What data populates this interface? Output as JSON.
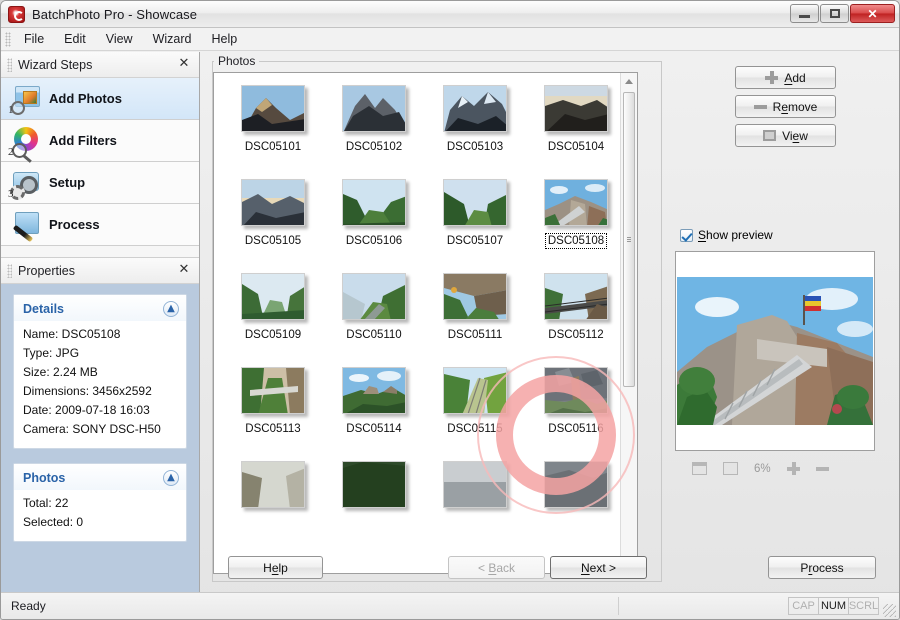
{
  "window": {
    "title": "BatchPhoto Pro - Showcase",
    "app_icon": "batchphoto-logo-icon",
    "minimize": "minimize-icon",
    "maximize": "maximize-icon",
    "close": "close-icon"
  },
  "menubar": {
    "items": [
      "File",
      "Edit",
      "View",
      "Wizard",
      "Help"
    ]
  },
  "sidebar": {
    "wizard": {
      "title": "Wizard Steps",
      "close": "✕",
      "steps": [
        {
          "num": "1",
          "label": "Add Photos",
          "icon": "add-photos-icon",
          "active": true
        },
        {
          "num": "2",
          "label": "Add Filters",
          "icon": "add-filters-icon",
          "active": false
        },
        {
          "num": "3",
          "label": "Setup",
          "icon": "setup-icon",
          "active": false
        },
        {
          "num": "",
          "label": "Process",
          "icon": "process-icon",
          "active": false
        }
      ]
    },
    "properties": {
      "title": "Properties",
      "close": "✕",
      "groups": [
        {
          "title": "Details",
          "collapse_icon": "chevron-up-icon",
          "lines": [
            "Name: DSC05108",
            "Type: JPG",
            "Size: 2.24 MB",
            "Dimensions: 3456x2592",
            "Date: 2009-07-18 16:03",
            "Camera: SONY DSC-H50"
          ]
        },
        {
          "title": "Photos",
          "collapse_icon": "chevron-up-icon",
          "lines": [
            "Total: 22",
            "Selected: 0"
          ]
        }
      ]
    }
  },
  "main": {
    "group_label": "Photos",
    "focused_photo": "DSC05108",
    "photos": [
      {
        "name": "DSC05101",
        "scene": "mountain-peak-dusk"
      },
      {
        "name": "DSC05102",
        "scene": "twin-rocky-peaks"
      },
      {
        "name": "DSC05103",
        "scene": "snowy-cliff"
      },
      {
        "name": "DSC05104",
        "scene": "dark-valley-ridge"
      },
      {
        "name": "DSC05105",
        "scene": "valley-sunrise"
      },
      {
        "name": "DSC05106",
        "scene": "green-gorge"
      },
      {
        "name": "DSC05107",
        "scene": "forest-valley"
      },
      {
        "name": "DSC05108",
        "scene": "castle-ruins"
      },
      {
        "name": "DSC05109",
        "scene": "misty-canyon"
      },
      {
        "name": "DSC05110",
        "scene": "cliff-road"
      },
      {
        "name": "DSC05111",
        "scene": "rock-overhang"
      },
      {
        "name": "DSC05112",
        "scene": "mountain-road-rail"
      },
      {
        "name": "DSC05113",
        "scene": "forest-trail"
      },
      {
        "name": "DSC05114",
        "scene": "hilltop-ruins"
      },
      {
        "name": "DSC05115",
        "scene": "green-slope-stairs"
      },
      {
        "name": "DSC05116",
        "scene": "rocky-stream"
      },
      {
        "name": "",
        "scene": "partial-road"
      },
      {
        "name": "",
        "scene": "partial-dark-trees"
      },
      {
        "name": "",
        "scene": "partial-grey-sky"
      },
      {
        "name": "",
        "scene": "partial-rocks"
      }
    ],
    "scrollbar": {
      "up": "scroll-up-arrow",
      "down": "scroll-down-arrow"
    }
  },
  "right": {
    "buttons": [
      {
        "label_pre": "",
        "accel": "A",
        "label_post": "dd",
        "icon": "plus-icon",
        "name": "add-button"
      },
      {
        "label_pre": "R",
        "accel": "e",
        "label_post": "move",
        "icon": "minus-icon",
        "name": "remove-button"
      },
      {
        "label_pre": "Vi",
        "accel": "e",
        "label_post": "w",
        "icon": "view-icon",
        "name": "view-button"
      }
    ],
    "show_preview": {
      "label_pre": "",
      "accel": "S",
      "label_post": "how preview",
      "checked": true
    },
    "preview_scene": "castle-ruins-stairs",
    "zoom": {
      "fit_icon": "fit-to-window-icon",
      "actual_icon": "actual-size-icon",
      "percent": "6%",
      "zoom_in_icon": "zoom-in-icon",
      "zoom_out_icon": "zoom-out-icon"
    }
  },
  "footer": {
    "help": {
      "pre": "H",
      "accel": "e",
      "post": "lp"
    },
    "back": {
      "pre": "< ",
      "accel": "B",
      "post": "ack",
      "disabled": true
    },
    "next": {
      "pre": "",
      "accel": "N",
      "post": "ext >",
      "disabled": false
    },
    "process": {
      "pre": "P",
      "accel": "r",
      "post": "ocess"
    }
  },
  "statusbar": {
    "message": "Ready",
    "indicators": [
      {
        "label": "CAP",
        "active": false
      },
      {
        "label": "NUM",
        "active": true
      },
      {
        "label": "SCRL",
        "active": false
      }
    ]
  },
  "annotation": {
    "type": "click-ring",
    "color": "#f5a3a3",
    "target": "DSC05116"
  }
}
